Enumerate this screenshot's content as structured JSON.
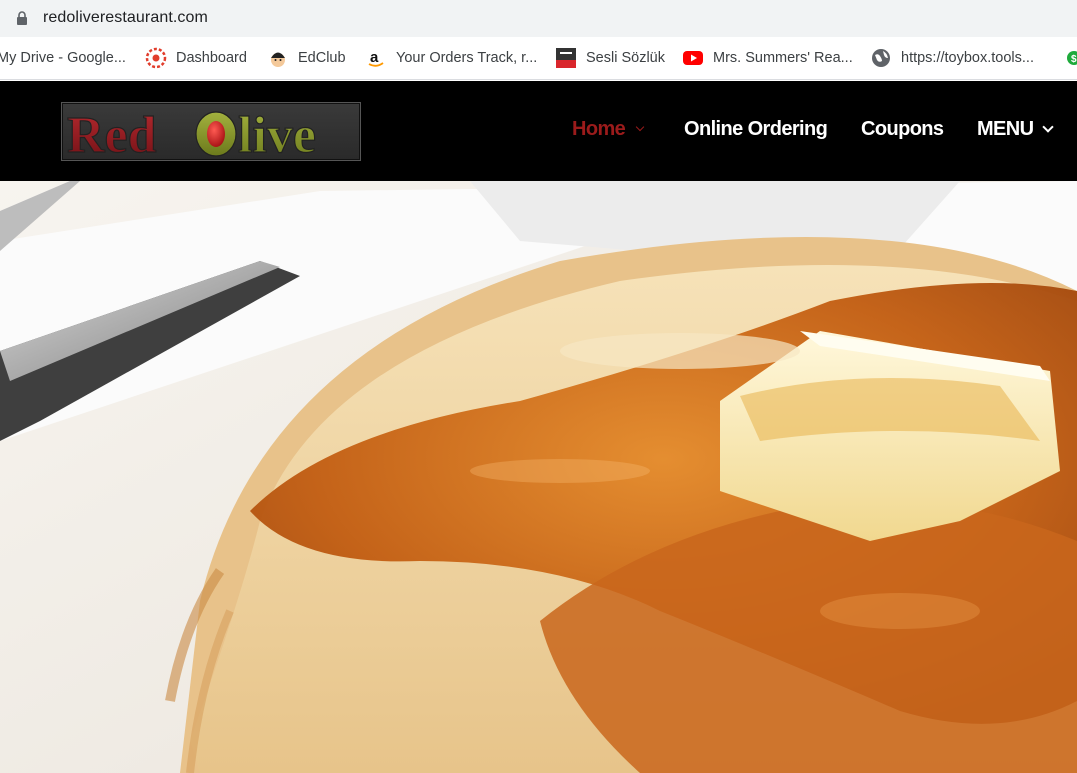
{
  "browser": {
    "url": "redoliverestaurant.com",
    "bookmarks": [
      {
        "label": "My Drive - Google...",
        "icon": "google-drive-icon"
      },
      {
        "label": "Dashboard",
        "icon": "canvas-icon"
      },
      {
        "label": "EdClub",
        "icon": "edclub-icon"
      },
      {
        "label": "Your Orders Track, r...",
        "icon": "amazon-icon"
      },
      {
        "label": "Sesli Sözlük",
        "icon": "sesli-sozluk-icon"
      },
      {
        "label": "Mrs. Summers' Rea...",
        "icon": "youtube-icon"
      },
      {
        "label": "https://toybox.tools...",
        "icon": "globe-icon"
      }
    ]
  },
  "site": {
    "logo": {
      "word1": "Red",
      "word2": "Olive"
    },
    "nav": [
      {
        "label": "Home",
        "active": true,
        "has_dropdown": true
      },
      {
        "label": "Online Ordering",
        "active": false,
        "has_dropdown": false
      },
      {
        "label": "Coupons",
        "active": false,
        "has_dropdown": false
      },
      {
        "label": "MENU",
        "active": false,
        "has_dropdown": true
      }
    ]
  },
  "colors": {
    "header_bg": "#000000",
    "nav_active": "#9b1b1b",
    "nav_text": "#ffffff",
    "logo_red": "#8b1a1f",
    "logo_olive": "#7f8f2a"
  },
  "hero": {
    "image": "pancakes-with-butter-and-syrup"
  }
}
